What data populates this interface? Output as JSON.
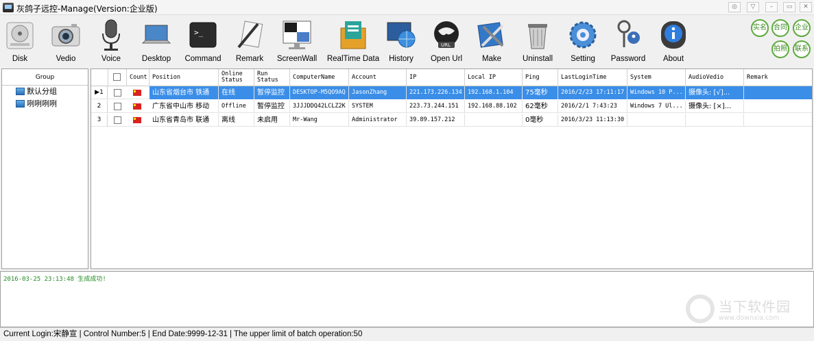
{
  "window": {
    "title": "灰鸽子远控-Manage(Version:企业版)",
    "controls": [
      "◎",
      "▽",
      "–",
      "▭",
      "✕"
    ]
  },
  "toolbar": {
    "items": [
      {
        "label": "Disk",
        "icon": "disk-icon"
      },
      {
        "label": "Vedio",
        "icon": "camera-icon"
      },
      {
        "label": "Voice",
        "icon": "microphone-icon"
      },
      {
        "label": "Desktop",
        "icon": "laptop-icon"
      },
      {
        "label": "Command",
        "icon": "terminal-icon"
      },
      {
        "label": "Remark",
        "icon": "pen-paper-icon"
      },
      {
        "label": "ScreenWall",
        "icon": "monitor-wall-icon"
      },
      {
        "label": "RealTime Data",
        "icon": "folder-chart-icon"
      },
      {
        "label": "History",
        "icon": "globe-screen-icon"
      },
      {
        "label": "Open Url",
        "icon": "url-globe-icon"
      },
      {
        "label": "Make",
        "icon": "tools-icon"
      },
      {
        "label": "Uninstall",
        "icon": "trash-icon"
      },
      {
        "label": "Setting",
        "icon": "gear-icon"
      },
      {
        "label": "Password",
        "icon": "keys-icon"
      },
      {
        "label": "About",
        "icon": "info-icon"
      }
    ],
    "round_buttons": [
      "实名",
      "合同",
      "企业",
      "拍照",
      "联系"
    ]
  },
  "groups": {
    "header": "Group",
    "items": [
      "默认分组",
      "咧咧咧咧"
    ]
  },
  "grid": {
    "columns": [
      {
        "label": "Count"
      },
      {
        "label": "Position"
      },
      {
        "label": "Online\nStatus"
      },
      {
        "label": "Run\nStatus"
      },
      {
        "label": "ComputerName"
      },
      {
        "label": "Account"
      },
      {
        "label": "IP"
      },
      {
        "label": "Local IP"
      },
      {
        "label": "Ping"
      },
      {
        "label": "LastLoginTime"
      },
      {
        "label": "System"
      },
      {
        "label": "AudioVedio"
      },
      {
        "label": "Remark"
      }
    ],
    "rows": [
      {
        "num": "1",
        "position": "山东省烟台市 铁通",
        "online": "在线",
        "run": "暂停监控",
        "computer": "DESKTOP-M5QO9AQ",
        "account": "JasonZhang",
        "ip": "221.173.226.134",
        "local_ip": "192.168.1.104",
        "ping": "75毫秒",
        "last_login": "2016/2/23 17:11:17",
        "system": "Windows 10 P...",
        "audio": "摄像头: [√]...",
        "remark": ""
      },
      {
        "num": "2",
        "position": "广东省中山市 移动",
        "online": "Offline",
        "run": "暂停监控",
        "computer": "3JJJDDQ42LCLZ2K",
        "account": "SYSTEM",
        "ip": "223.73.244.151",
        "local_ip": "192.168.88.102",
        "ping": "62毫秒",
        "last_login": "2016/2/1 7:43:23",
        "system": "Windows 7 Ul...",
        "audio": "摄像头: [×]...",
        "remark": ""
      },
      {
        "num": "3",
        "position": "山东省青岛市 联通",
        "online": "离线",
        "run": "未启用",
        "computer": "Mr-Wang",
        "account": "Administrator",
        "ip": "39.89.157.212",
        "local_ip": "",
        "ping": "0毫秒",
        "last_login": "2016/3/23 11:13:30",
        "system": "",
        "audio": "",
        "remark": ""
      }
    ]
  },
  "log": {
    "line": "2016-03-25  23:13:48 生成成功!"
  },
  "watermark": {
    "text": "当下软件园",
    "url": "www.downxia.com"
  },
  "status": {
    "text": "Current Login:宋静宣 | Control Number:5 | End Date:9999-12-31 | The upper limit of batch operation:50"
  }
}
